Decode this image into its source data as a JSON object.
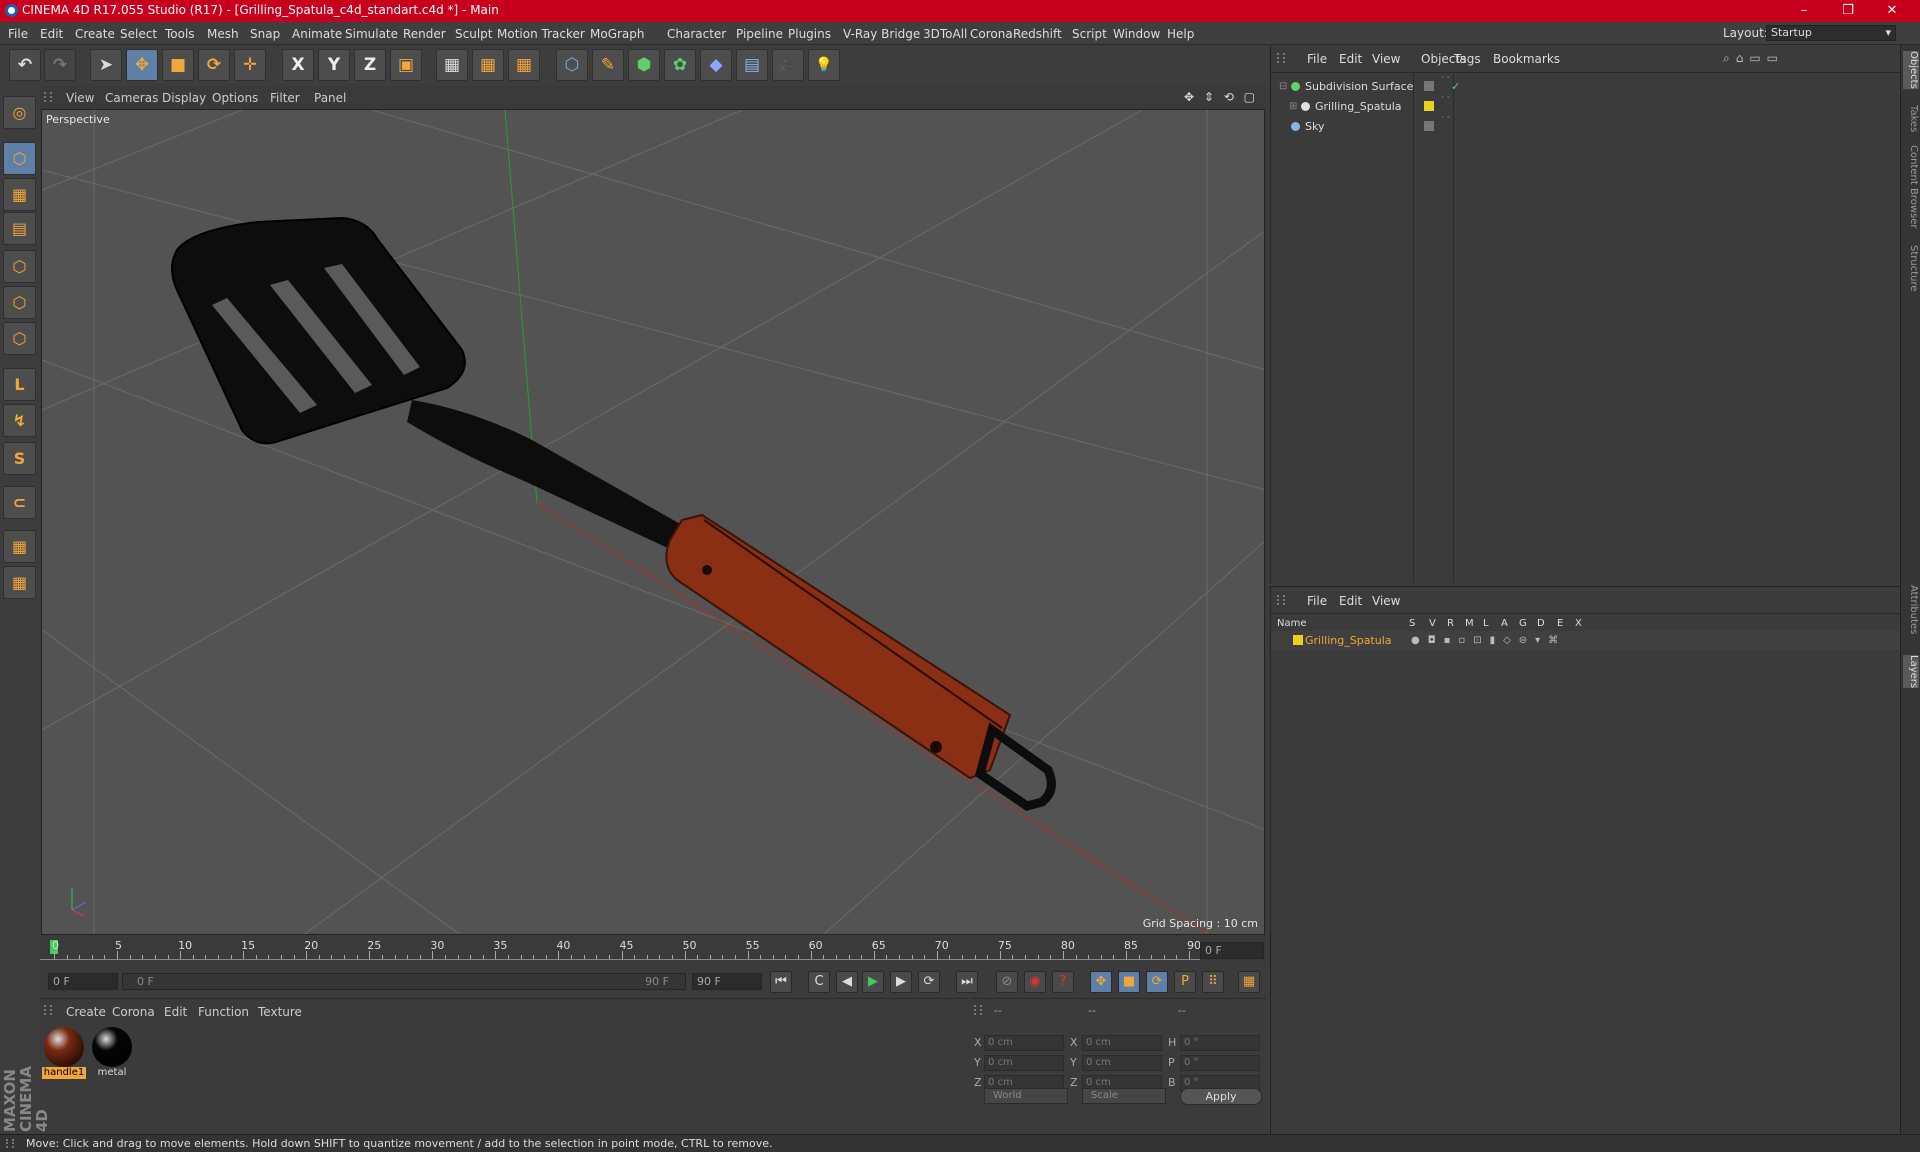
{
  "window": {
    "title": "CINEMA 4D R17.055 Studio (R17) - [Grilling_Spatula_c4d_standart.c4d *] - Main",
    "layout_label": "Layout:",
    "layout_value": "Startup",
    "minimize": "–",
    "maximize": "❐",
    "close": "✕"
  },
  "menu": [
    "File",
    "Edit",
    "Create",
    "Select",
    "Tools",
    "Mesh",
    "Snap",
    "Animate",
    "Simulate",
    "Render",
    "Sculpt",
    "Motion Tracker",
    "MoGraph",
    "Character",
    "Pipeline",
    "Plugins",
    "V-Ray Bridge",
    "3DToAll",
    "Corona",
    "Redshift",
    "Script",
    "Window",
    "Help"
  ],
  "toolbar": {
    "undo": "↶",
    "redo": "↷",
    "select": "➤",
    "move": "✥",
    "scale": "■",
    "rotate": "⟳",
    "transform": "✛",
    "axis_x": "X",
    "axis_y": "Y",
    "axis_z": "Z",
    "coord": "▣",
    "render_view": "▦",
    "render_pic": "▦",
    "render_settings": "▦",
    "cube": "⬡",
    "pen": "✎",
    "subdiv": "⬢",
    "cloner": "✿",
    "deformer": "◆",
    "floor": "▤",
    "camera": "🎥",
    "light": "💡"
  },
  "left_tools": [
    "◎",
    "⬡",
    "▦",
    "▤",
    "⬡",
    "⬡",
    "⬡",
    "L",
    "↯",
    "S",
    "⊂",
    "▦",
    "▦"
  ],
  "viewport": {
    "menu": [
      "View",
      "Cameras",
      "Display",
      "Options",
      "Filter",
      "Panel"
    ],
    "label": "Perspective",
    "grid_spacing": "Grid Spacing : 10 cm",
    "nav_icons": "✥ ⇕ ⟲ ▢"
  },
  "timeline": {
    "ticks": [
      "0",
      "5",
      "10",
      "15",
      "20",
      "25",
      "30",
      "35",
      "40",
      "45",
      "50",
      "55",
      "60",
      "65",
      "70",
      "75",
      "80",
      "85",
      "90"
    ],
    "current_frame": "0 F"
  },
  "transport": {
    "start": "0 F",
    "range_start": "0 F",
    "range_end": "90 F",
    "end": "90 F",
    "buttons": [
      "⏮",
      "C",
      "◀",
      "▶",
      "▶",
      "⟳",
      "⏭"
    ],
    "record_buttons": [
      "⊘",
      "◉",
      "?"
    ],
    "key_buttons": [
      "✥",
      "■",
      "⟳",
      "P",
      "⠿",
      "▦"
    ]
  },
  "materials": {
    "menu": [
      "Create",
      "Corona",
      "Edit",
      "Function",
      "Texture"
    ],
    "items": [
      {
        "name": "handle1",
        "color": "#7a2a10",
        "selected": true
      },
      {
        "name": "metal",
        "color": "#050505",
        "selected": false
      }
    ]
  },
  "coordinates": {
    "header": [
      "--",
      "--",
      "--"
    ],
    "rows": [
      {
        "a": "X",
        "av": "0 cm",
        "b": "X",
        "bv": "0 cm",
        "c": "H",
        "cv": "0 °"
      },
      {
        "a": "Y",
        "av": "0 cm",
        "b": "Y",
        "bv": "0 cm",
        "c": "P",
        "cv": "0 °"
      },
      {
        "a": "Z",
        "av": "0 cm",
        "b": "Z",
        "bv": "0 cm",
        "c": "B",
        "cv": "0 °"
      }
    ],
    "mode1": "World",
    "mode2": "Scale",
    "apply": "Apply"
  },
  "objects_panel": {
    "menu": [
      "File",
      "Edit",
      "View",
      "Objects",
      "Tags",
      "Bookmarks"
    ],
    "items": [
      {
        "name": "Subdivision Surface",
        "indent": 0
      },
      {
        "name": "Grilling_Spatula",
        "indent": 1
      },
      {
        "name": "Sky",
        "indent": 0
      }
    ]
  },
  "layers_panel": {
    "menu": [
      "File",
      "Edit",
      "View"
    ],
    "columns": [
      "Name",
      "S",
      "V",
      "R",
      "M",
      "L",
      "A",
      "G",
      "D",
      "E",
      "X"
    ],
    "items": [
      {
        "name": "Grilling_Spatula",
        "color": "#e8d21e"
      }
    ]
  },
  "right_tabs": [
    "Objects",
    "Takes",
    "Content Browser",
    "Structure",
    "Attributes",
    "Layers"
  ],
  "brand": "MAXON CINEMA 4D",
  "status": "Move: Click and drag to move elements. Hold down SHIFT to quantize movement / add to the selection in point mode, CTRL to remove.",
  "colors": {
    "title_bar": "#c8001e",
    "accent": "#f3a63a",
    "selected_layer_text": "#f3a63a"
  }
}
